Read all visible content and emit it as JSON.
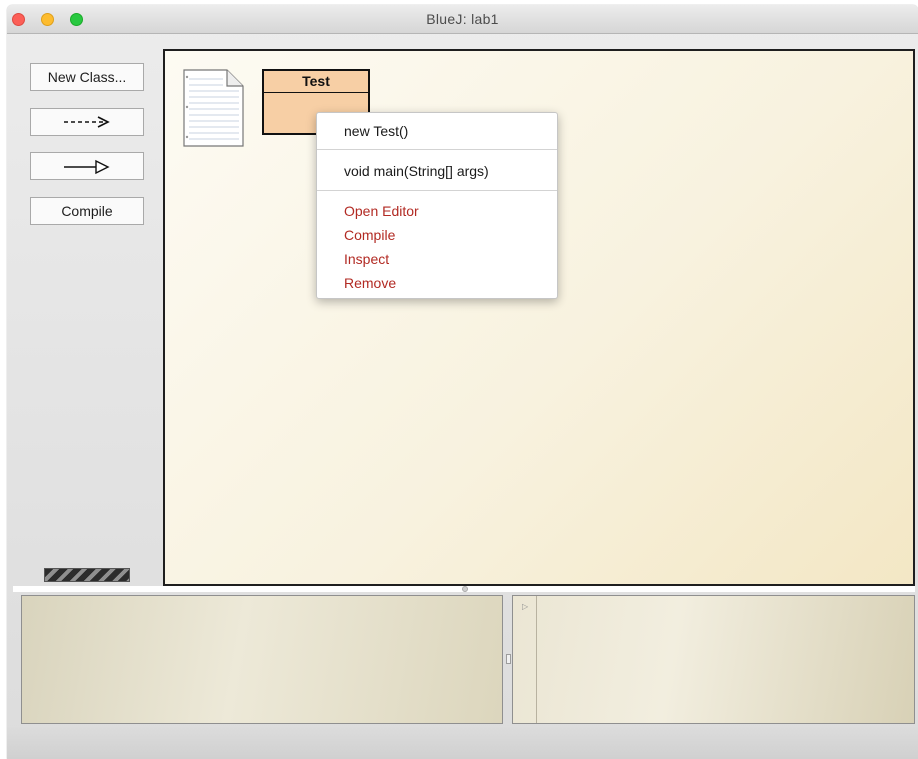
{
  "window": {
    "title": "BlueJ:  lab1"
  },
  "toolbar": {
    "new_class_label": "New Class...",
    "dependency_arrow_icon": "dashed-arrow-icon",
    "inheritance_arrow_icon": "hollow-arrow-icon",
    "dependency_arrow_label": "--->",
    "compile_label": "Compile"
  },
  "diagram": {
    "readme_icon": "readme-document-icon",
    "classes": [
      {
        "name": "Test",
        "color": "#f7cfa5"
      }
    ]
  },
  "context_menu": {
    "constructor_items": [
      "new Test()"
    ],
    "method_items": [
      "void main(String[] args)"
    ],
    "action_items": [
      "Open Editor",
      "Compile",
      "Inspect",
      "Remove"
    ],
    "action_color": "#b22a23"
  },
  "codepad": {
    "prompt_icon": "prompt-arrow-icon"
  },
  "colors": {
    "canvas_background": "#f8f2df",
    "class_fill": "#f7cfa5",
    "close_button": "#fc5f57",
    "minimize_button": "#fdbc2f",
    "maximize_button": "#28c840"
  }
}
